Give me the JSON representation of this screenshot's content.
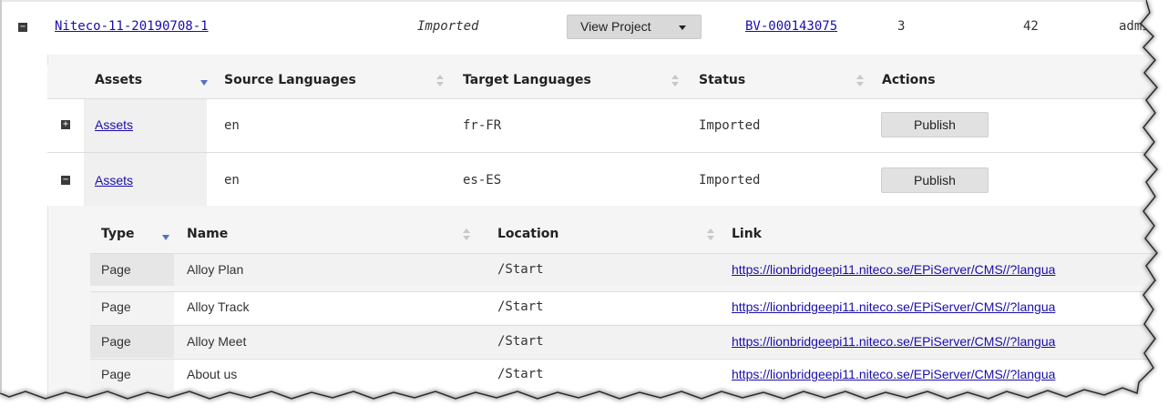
{
  "project_row": {
    "toggle_symbol": "−",
    "project_name": "Niteco-11-20190708-1",
    "status": "Imported",
    "view_project_label": "View Project",
    "bv_id": "BV-000143075",
    "count_a": "3",
    "count_b": "42",
    "user": "admi"
  },
  "assets_table": {
    "headers": [
      "Assets",
      "Source Languages",
      "Target Languages",
      "Status",
      "Actions"
    ],
    "rows": [
      {
        "toggle": "+",
        "asset": "Assets",
        "source": "en",
        "target": "fr-FR",
        "status": "Imported",
        "action": "Publish"
      },
      {
        "toggle": "−",
        "asset": "Assets",
        "source": "en",
        "target": "es-ES",
        "status": "Imported",
        "action": "Publish"
      }
    ]
  },
  "items_table": {
    "headers": [
      "Type",
      "Name",
      "Location",
      "Link"
    ],
    "rows": [
      {
        "type": "Page",
        "name": "Alloy Plan",
        "location": "/Start",
        "link": "https://lionbridgeepi11.niteco.se/EPiServer/CMS//?langua"
      },
      {
        "type": "Page",
        "name": "Alloy Track",
        "location": "/Start",
        "link": "https://lionbridgeepi11.niteco.se/EPiServer/CMS//?langua"
      },
      {
        "type": "Page",
        "name": "Alloy Meet",
        "location": "/Start",
        "link": "https://lionbridgeepi11.niteco.se/EPiServer/CMS//?langua"
      },
      {
        "type": "Page",
        "name": "About us",
        "location": "/Start",
        "link": "https://lionbridgeepi11.niteco.se/EPiServer/CMS//?langua"
      }
    ]
  },
  "colors": {
    "link": "#1a0dab",
    "sort_active": "#5470c6",
    "panel_bg": "#f5f5f5",
    "button_bg": "#e1e1e1"
  }
}
